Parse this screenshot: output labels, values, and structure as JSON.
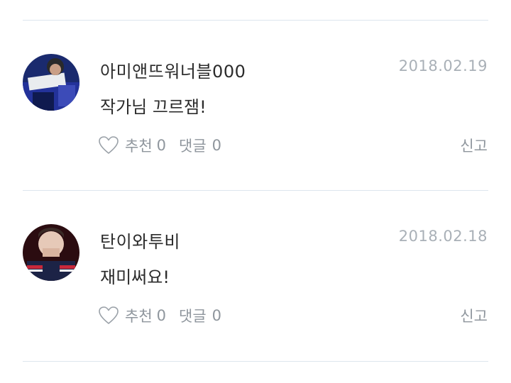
{
  "comments": [
    {
      "username": "아미앤뜨워너블000",
      "date": "2018.02.19",
      "text": "작가님 끄르잼!",
      "like_label": "추천",
      "like_count": "0",
      "reply_label": "댓글",
      "reply_count": "0",
      "report_label": "신고",
      "avatar_icon": "user-avatar-photo"
    },
    {
      "username": "탄이와투비",
      "date": "2018.02.18",
      "text": "재미써요!",
      "like_label": "추천",
      "like_count": "0",
      "reply_label": "댓글",
      "reply_count": "0",
      "report_label": "신고",
      "avatar_icon": "user-avatar-photo"
    }
  ],
  "icons": {
    "like": "heart-outline-icon"
  },
  "colors": {
    "divider": "#dde6ee",
    "muted": "#8f969d",
    "date": "#a9b0b7",
    "text": "#2b2b2b"
  }
}
